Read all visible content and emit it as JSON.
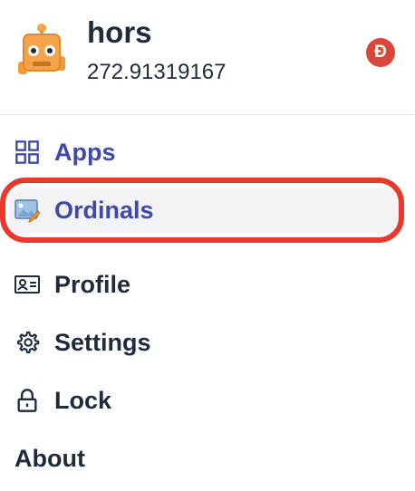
{
  "account": {
    "name": "hors",
    "balance": "272.91319167",
    "coin_symbol": "Ð"
  },
  "menu": {
    "items": [
      {
        "label": "Apps",
        "icon": "apps-grid-icon",
        "active": true
      },
      {
        "label": "Ordinals",
        "icon": "ordinals-image-icon",
        "active": true,
        "selected": true,
        "highlighted": true
      },
      {
        "label": "Profile",
        "icon": "profile-card-icon"
      },
      {
        "label": "Settings",
        "icon": "gear-icon"
      },
      {
        "label": "Lock",
        "icon": "lock-icon"
      },
      {
        "label": "About",
        "icon": ""
      }
    ]
  },
  "colors": {
    "text": "#1f2a3a",
    "accent": "#3f4aa8",
    "coin_badge": "#d9473b",
    "highlight_ring": "#e8392a",
    "selected_bg": "#f3f3f5"
  }
}
